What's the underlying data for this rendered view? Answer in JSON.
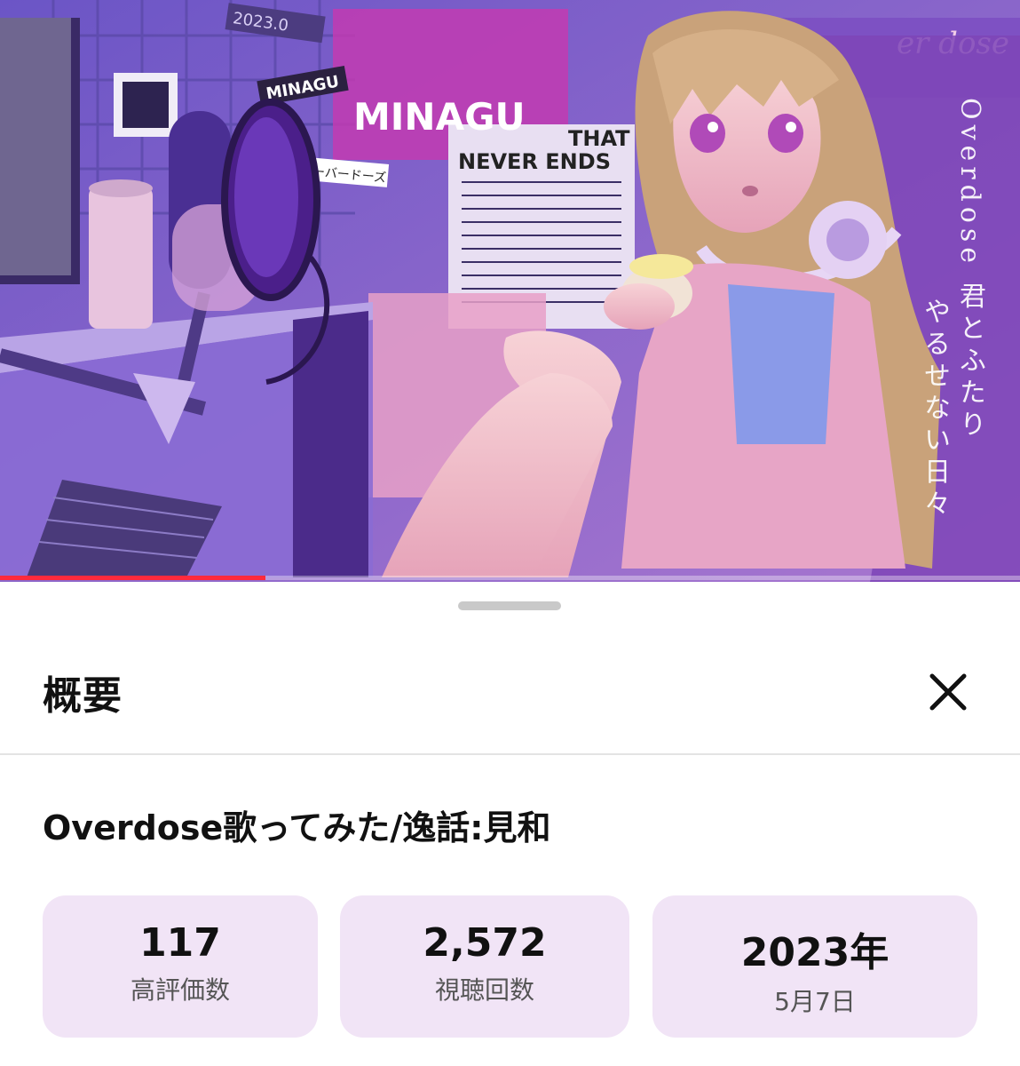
{
  "video": {
    "poster_text": {
      "minagu": "MINAGU",
      "that": "THAT",
      "never_ends": "NEVER ENDS",
      "sign_minagu": "MINAGU",
      "sign_kana": "オーバードーズ",
      "date_tag": "2023.0",
      "corner_tag": "er dose"
    },
    "vertical_line1": "Overdose 君とふたり",
    "vertical_line2": "やるせない日々",
    "progress_percent": 26
  },
  "sheet": {
    "title": "概要",
    "video_title": "Overdose歌ってみた/逸話:見和",
    "stats": [
      {
        "value": "117",
        "label": "高評価数"
      },
      {
        "value": "2,572",
        "label": "視聴回数"
      },
      {
        "value": "2023年",
        "label": "5月7日"
      }
    ]
  },
  "colors": {
    "accent_progress": "#ff2a3d",
    "stat_bg": "#f1e4f6",
    "video_purple": "#7a5fc8"
  },
  "icons": {
    "close": "close-icon"
  }
}
